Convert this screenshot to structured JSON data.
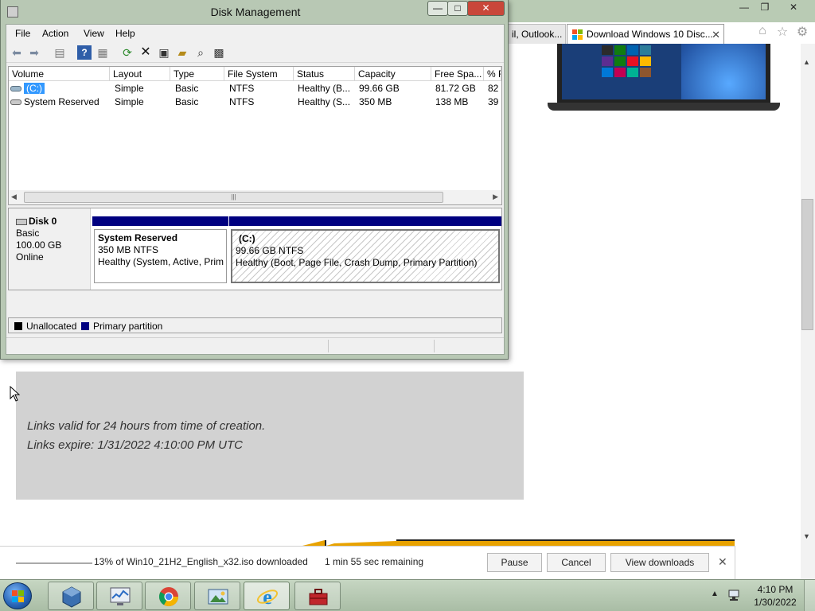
{
  "browser": {
    "tabs": [
      {
        "label": "il, Outlook...",
        "active": false
      },
      {
        "label": "Download Windows 10 Disc...",
        "active": true
      }
    ],
    "tab_close": "✕",
    "window_controls": {
      "minimize": "—",
      "maximize": "❐",
      "close": "✕"
    },
    "toolbar_icons": [
      "home-icon",
      "favorites-star-icon",
      "settings-gear-icon"
    ],
    "info_box": {
      "line1": "Links valid for 24 hours from time of creation.",
      "line2": "Links expire: 1/31/2022 4:10:00 PM UTC"
    }
  },
  "download_bar": {
    "progress_percent": 13,
    "status_text": "13% of Win10_21H2_English_x32.iso downloaded",
    "remaining_text": "1 min 55 sec remaining",
    "pause_label": "Pause",
    "cancel_label": "Cancel",
    "view_downloads_label": "View downloads",
    "close_label": "✕"
  },
  "disk_management": {
    "title": "Disk Management",
    "window_controls": {
      "minimize": "—",
      "maximize": "□",
      "close": "✕"
    },
    "menu": [
      "File",
      "Action",
      "View",
      "Help"
    ],
    "toolbar_icons": [
      "back-icon",
      "forward-icon",
      "console-tree-icon",
      "help-icon",
      "action-pane-icon",
      "refresh-icon",
      "delete-icon",
      "properties-icon",
      "open-icon",
      "search-icon",
      "console-icon"
    ],
    "columns": [
      "Volume",
      "Layout",
      "Type",
      "File System",
      "Status",
      "Capacity",
      "Free Spa...",
      "% F"
    ],
    "volumes": [
      {
        "volume": "(C:)",
        "layout": "Simple",
        "type": "Basic",
        "fs": "NTFS",
        "status": "Healthy (B...",
        "capacity": "99.66 GB",
        "free": "81.72 GB",
        "pct": "82",
        "selected": true
      },
      {
        "volume": "System Reserved",
        "layout": "Simple",
        "type": "Basic",
        "fs": "NTFS",
        "status": "Healthy (S...",
        "capacity": "350 MB",
        "free": "138 MB",
        "pct": "39",
        "selected": false
      }
    ],
    "scroll_arrows": {
      "left": "◀",
      "right": "▶",
      "grip": "|||"
    },
    "disk": {
      "name": "Disk 0",
      "type": "Basic",
      "size": "100.00 GB",
      "state": "Online"
    },
    "partitions": [
      {
        "name": "System Reserved",
        "size_fs": "350 MB NTFS",
        "status": "Healthy (System, Active, Prim"
      },
      {
        "name": "(C:)",
        "size_fs": "99.66 GB NTFS",
        "status": "Healthy (Boot, Page File, Crash Dump, Primary Partition)"
      }
    ],
    "legend": [
      {
        "label": "Unallocated",
        "color": "#000000"
      },
      {
        "label": "Primary partition",
        "color": "#000080"
      }
    ]
  },
  "taskbar": {
    "pinned": [
      "virtualbox-icon",
      "performance-monitor-icon",
      "chrome-icon",
      "photo-viewer-icon",
      "internet-explorer-icon",
      "toolbox-icon"
    ],
    "clock_time": "4:10 PM",
    "clock_date": "1/30/2022"
  },
  "colors": {
    "primary_partition": "#000080",
    "download_progress_orange": "#e8a200",
    "title_bar": "#b8c8b4"
  }
}
